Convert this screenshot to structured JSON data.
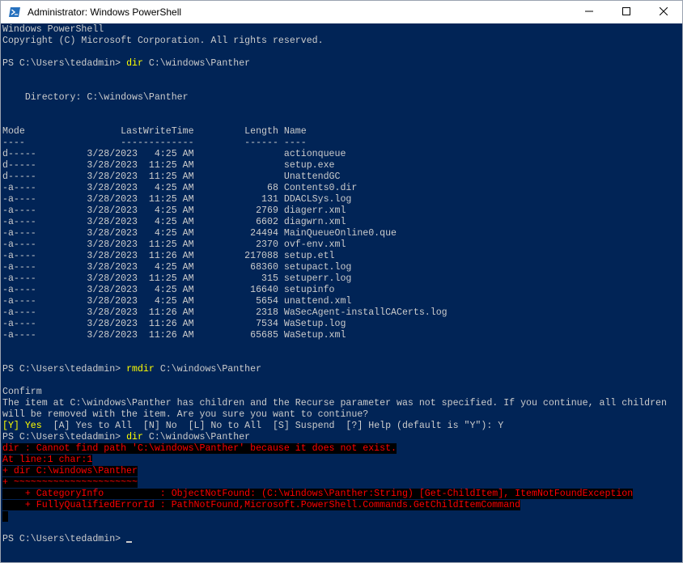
{
  "window": {
    "title": "Administrator: Windows PowerShell",
    "icon": "powershell-icon",
    "controls": {
      "minimize_icon": "minimize-icon",
      "maximize_icon": "maximize-icon",
      "close_icon": "close-icon"
    },
    "colors": {
      "console_background": "#012456",
      "text": "#cccccc",
      "command": "#ffff00",
      "error_text": "#ff0000",
      "error_background": "#000000"
    }
  },
  "console": {
    "lines": [
      {
        "text": "Windows PowerShell",
        "kind": "output"
      },
      {
        "text": "Copyright (C) Microsoft Corporation. All rights reserved.",
        "kind": "output"
      },
      {
        "text": "",
        "kind": "output"
      },
      {
        "prompt": "PS C:\\Users\\tedadmin> ",
        "command": "dir",
        "args": " C:\\windows\\Panther",
        "kind": "prompt"
      },
      {
        "text": "",
        "kind": "output"
      },
      {
        "text": "",
        "kind": "output"
      },
      {
        "text": "    Directory: C:\\windows\\Panther",
        "kind": "output"
      },
      {
        "text": "",
        "kind": "output"
      },
      {
        "text": "",
        "kind": "output"
      },
      {
        "text": "Mode                 LastWriteTime         Length Name",
        "kind": "output"
      },
      {
        "text": "----                 -------------         ------ ----",
        "kind": "output"
      },
      {
        "text": "d-----         3/28/2023   4:25 AM                actionqueue",
        "kind": "output"
      },
      {
        "text": "d-----         3/28/2023  11:25 AM                setup.exe",
        "kind": "output"
      },
      {
        "text": "d-----         3/28/2023  11:25 AM                UnattendGC",
        "kind": "output"
      },
      {
        "text": "-a----         3/28/2023   4:25 AM             68 Contents0.dir",
        "kind": "output"
      },
      {
        "text": "-a----         3/28/2023  11:25 AM            131 DDACLSys.log",
        "kind": "output"
      },
      {
        "text": "-a----         3/28/2023   4:25 AM           2769 diagerr.xml",
        "kind": "output"
      },
      {
        "text": "-a----         3/28/2023   4:25 AM           6602 diagwrn.xml",
        "kind": "output"
      },
      {
        "text": "-a----         3/28/2023   4:25 AM          24494 MainQueueOnline0.que",
        "kind": "output"
      },
      {
        "text": "-a----         3/28/2023  11:25 AM           2370 ovf-env.xml",
        "kind": "output"
      },
      {
        "text": "-a----         3/28/2023  11:26 AM         217088 setup.etl",
        "kind": "output"
      },
      {
        "text": "-a----         3/28/2023   4:25 AM          68360 setupact.log",
        "kind": "output"
      },
      {
        "text": "-a----         3/28/2023  11:25 AM            315 setuperr.log",
        "kind": "output"
      },
      {
        "text": "-a----         3/28/2023   4:25 AM          16640 setupinfo",
        "kind": "output"
      },
      {
        "text": "-a----         3/28/2023   4:25 AM           5654 unattend.xml",
        "kind": "output"
      },
      {
        "text": "-a----         3/28/2023  11:26 AM           2318 WaSecAgent-installCACerts.log",
        "kind": "output"
      },
      {
        "text": "-a----         3/28/2023  11:26 AM           7534 WaSetup.log",
        "kind": "output"
      },
      {
        "text": "-a----         3/28/2023  11:26 AM          65685 WaSetup.xml",
        "kind": "output"
      },
      {
        "text": "",
        "kind": "output"
      },
      {
        "text": "",
        "kind": "output"
      },
      {
        "prompt": "PS C:\\Users\\tedadmin> ",
        "command": "rmdir",
        "args": " C:\\windows\\Panther",
        "kind": "prompt"
      },
      {
        "text": "",
        "kind": "output"
      },
      {
        "text": "Confirm",
        "kind": "output"
      },
      {
        "text": "The item at C:\\windows\\Panther has children and the Recurse parameter was not specified. If you continue, all children",
        "kind": "output"
      },
      {
        "text": "will be removed with the item. Are you sure you want to continue?",
        "kind": "output"
      },
      {
        "highlight": "[Y] Yes",
        "text": "  [A] Yes to All  [N] No  [L] No to All  [S] Suspend  [?] Help (default is \"Y\"): Y",
        "kind": "choice"
      },
      {
        "prompt": "PS C:\\Users\\tedadmin> ",
        "command": "dir",
        "args": " C:\\windows\\Panther",
        "kind": "prompt"
      },
      {
        "text": "dir : Cannot find path 'C:\\windows\\Panther' because it does not exist.",
        "kind": "error"
      },
      {
        "text": "At line:1 char:1",
        "kind": "error"
      },
      {
        "text": "+ dir C:\\windows\\Panther",
        "kind": "error"
      },
      {
        "text": "+ ~~~~~~~~~~~~~~~~~~~~~~",
        "kind": "error"
      },
      {
        "text": "    + CategoryInfo          : ObjectNotFound: (C:\\windows\\Panther:String) [Get-ChildItem], ItemNotFoundException",
        "kind": "error"
      },
      {
        "text": "    + FullyQualifiedErrorId : PathNotFound,Microsoft.PowerShell.Commands.GetChildItemCommand",
        "kind": "error"
      },
      {
        "text": " ",
        "kind": "error"
      },
      {
        "text": "",
        "kind": "output"
      },
      {
        "prompt": "PS C:\\Users\\tedadmin> ",
        "command": "",
        "args": "",
        "kind": "active-prompt"
      }
    ]
  }
}
